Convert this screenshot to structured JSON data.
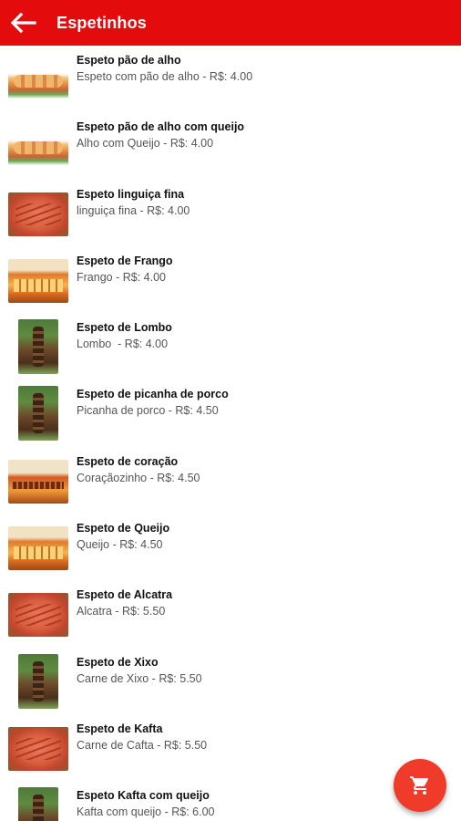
{
  "appbar": {
    "title": "Espetinhos",
    "background": "#e30b0b",
    "back_icon": "arrow-left-icon"
  },
  "items": [
    {
      "title": "Espeto pão de alho",
      "subtitle": "Espeto com pão de alho - R$: 4.00",
      "image": "bread"
    },
    {
      "title": "Espeto pão de alho com queijo",
      "subtitle": "Alho com Queijo - R$: 4.00",
      "image": "bread"
    },
    {
      "title": "Espeto linguiça fina",
      "subtitle": "linguiça fina - R$: 4.00",
      "image": "board"
    },
    {
      "title": "Espeto de Frango",
      "subtitle": "Frango - R$: 4.00",
      "image": "tray"
    },
    {
      "title": "Espeto de Lombo",
      "subtitle": "Lombo  - R$: 4.00",
      "image": "stick"
    },
    {
      "title": "Espeto de picanha de porco",
      "subtitle": "Picanha de porco - R$: 4.50",
      "image": "stick"
    },
    {
      "title": "Espeto de coração",
      "subtitle": "Coraçãozinho - R$: 4.50",
      "image": "heart"
    },
    {
      "title": "Espeto de Queijo",
      "subtitle": "Queijo - R$: 4.50",
      "image": "tray"
    },
    {
      "title": "Espeto de Alcatra",
      "subtitle": "Alcatra - R$: 5.50",
      "image": "board"
    },
    {
      "title": "Espeto de Xixo",
      "subtitle": "Carne de Xixo - R$: 5.50",
      "image": "stick"
    },
    {
      "title": "Espeto de Kafta",
      "subtitle": "Carne de Cafta - R$: 5.50",
      "image": "board"
    },
    {
      "title": "Espeto Kafta com queijo",
      "subtitle": "Kafta com queijo - R$: 6.00",
      "image": "stick"
    }
  ],
  "fab": {
    "icon": "shopping-cart-icon",
    "color": "#f03a2a"
  }
}
